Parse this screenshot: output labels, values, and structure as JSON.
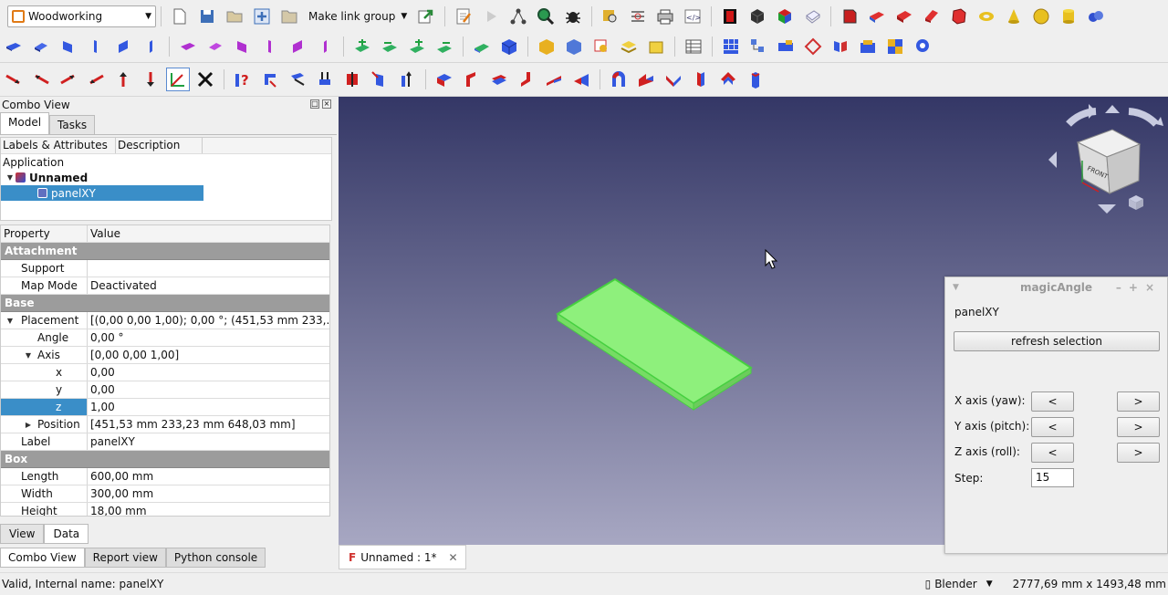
{
  "toolbar": {
    "workbench": "Woodworking",
    "make_link_group": "Make link group"
  },
  "combo": {
    "title": "Combo View",
    "tabs": [
      "Model",
      "Tasks"
    ],
    "tree_headers": [
      "Labels & Attributes",
      "Description"
    ],
    "tree": {
      "app": "Application",
      "doc": "Unnamed",
      "item": "panelXY"
    },
    "prop_headers": [
      "Property",
      "Value"
    ],
    "props": {
      "attachment": "Attachment",
      "support": "Support",
      "support_val": "",
      "mapmode": "Map Mode",
      "mapmode_val": "Deactivated",
      "base": "Base",
      "placement": "Placement",
      "placement_val": "[(0,00 0,00 1,00); 0,00 °; (451,53 mm  233,...",
      "angle": "Angle",
      "angle_val": "0,00 °",
      "axis": "Axis",
      "axis_val": "[0,00 0,00 1,00]",
      "x": "x",
      "x_val": "0,00",
      "y": "y",
      "y_val": "0,00",
      "z": "z",
      "z_val": "1,00",
      "position": "Position",
      "position_val": "[451,53 mm  233,23 mm  648,03 mm]",
      "label": "Label",
      "label_val": "panelXY",
      "box": "Box",
      "length": "Length",
      "length_val": "600,00 mm",
      "width": "Width",
      "width_val": "300,00 mm",
      "height": "Height",
      "height_val": "18,00 mm"
    },
    "bottom_tabs": [
      "View",
      "Data"
    ]
  },
  "panel_tabs": [
    "Combo View",
    "Report view",
    "Python console"
  ],
  "doc_tab": "Unnamed : 1*",
  "navcube": {
    "front": "FRONT"
  },
  "dialog": {
    "title": "magicAngle",
    "object": "panelXY",
    "refresh": "refresh selection",
    "x_axis": "X axis (yaw):",
    "y_axis": "Y axis (pitch):",
    "z_axis": "Z axis (roll):",
    "prev": "<",
    "next": ">",
    "step_label": "Step:",
    "step_value": "15"
  },
  "status": {
    "message": "Valid, Internal name: panelXY",
    "nav_style": "Blender",
    "dimensions": "2777,69 mm x 1493,48 mm"
  },
  "colors": {
    "panel_fill": "#8ef07c",
    "selection": "#3a8ec8",
    "group_header": "#9c9c9c"
  }
}
